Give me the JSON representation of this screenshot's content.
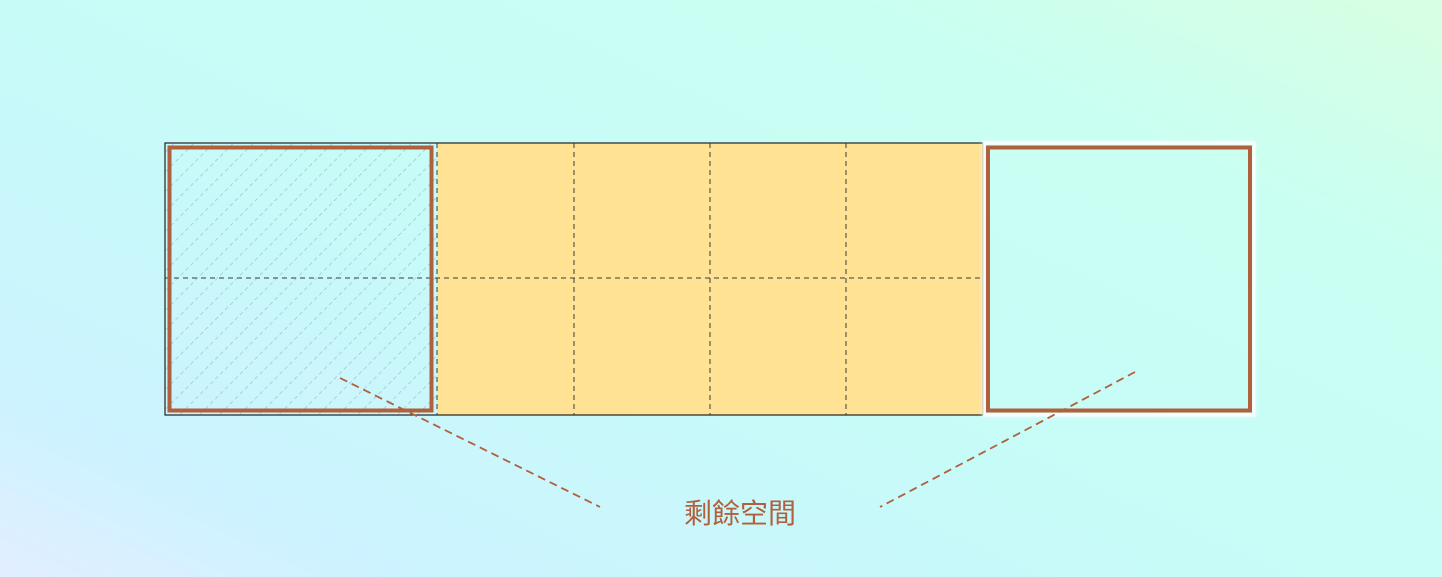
{
  "colors": {
    "accent": "#b0603c",
    "cell_fill": "#ffe294",
    "grid_line": "#3a3a3a",
    "hatch": "#9bbcc6"
  },
  "grid": {
    "columns": 6,
    "rows": 2,
    "overflow_columns": 2
  },
  "annotation": {
    "label": "剩餘空間"
  }
}
